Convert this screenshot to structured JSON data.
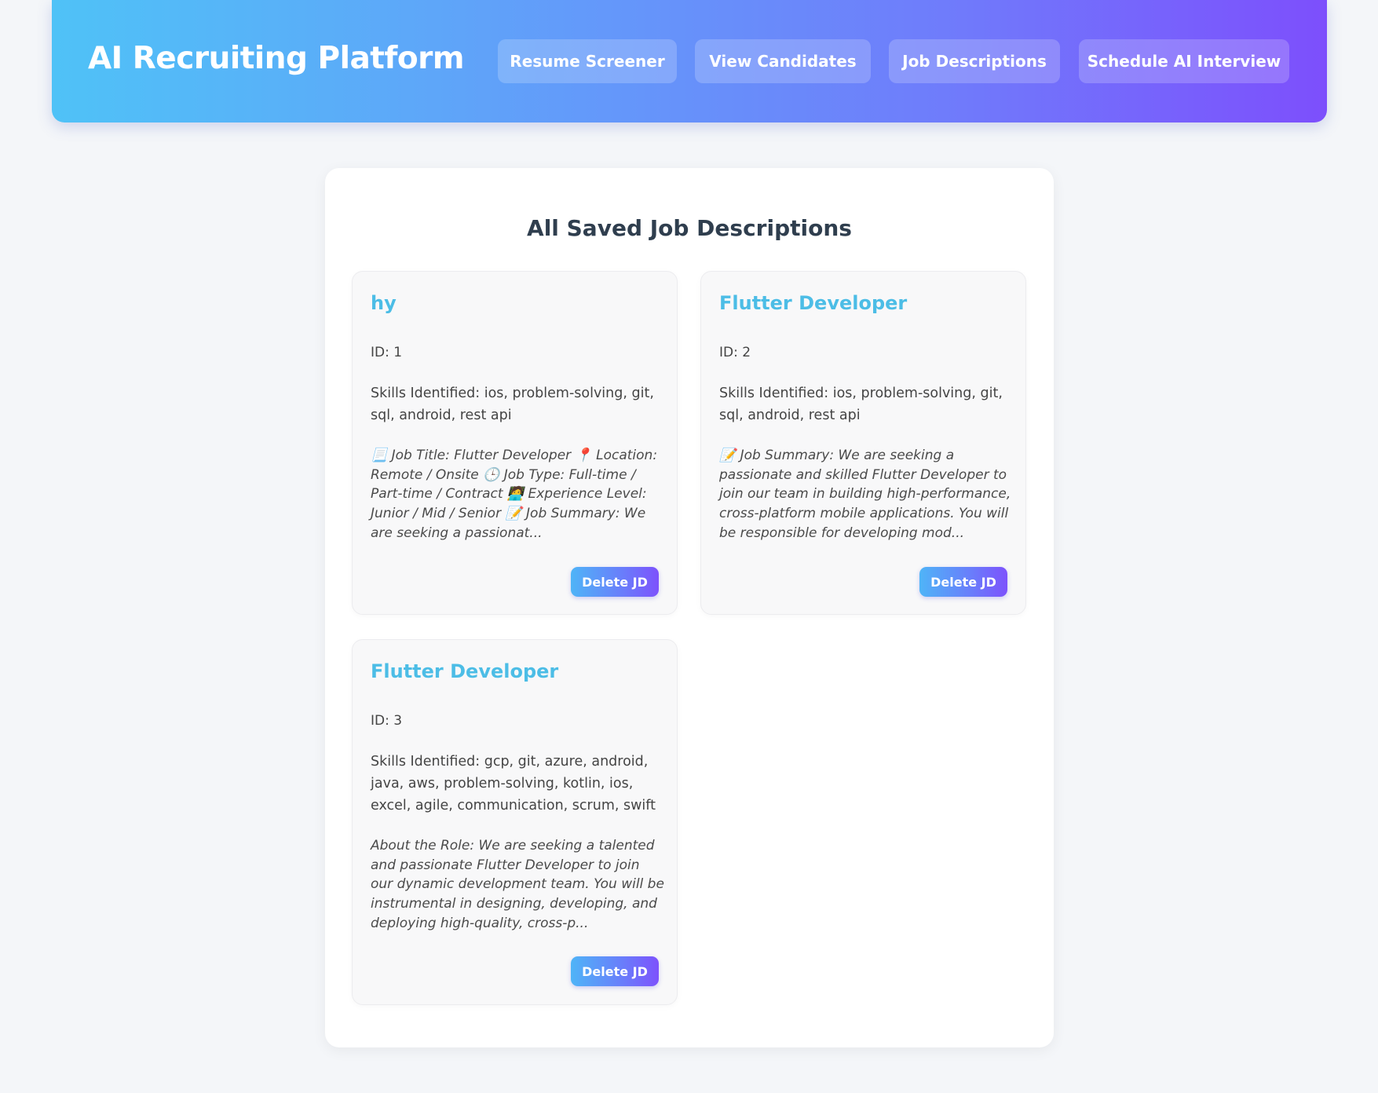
{
  "header": {
    "brand": "AI Recruiting Platform",
    "nav": [
      {
        "label": "Resume Screener"
      },
      {
        "label": "View Candidates"
      },
      {
        "label": "Job Descriptions"
      },
      {
        "label": "Schedule AI Interview"
      }
    ]
  },
  "main": {
    "title": "All Saved Job Descriptions",
    "cards": [
      {
        "title": "hy",
        "id_text": "ID: 1",
        "skills": "Skills Identified: ios, problem-solving, git, sql, android, rest api",
        "description": "📃 Job Title: Flutter Developer 📍 Location: Remote / Onsite 🕒 Job Type: Full-time / Part-time / Contract 🧑‍💻 Experience Level: Junior / Mid / Senior 📝 Job Summary: We are seeking a passionat...",
        "delete_label": "Delete JD"
      },
      {
        "title": "Flutter Developer",
        "id_text": "ID: 2",
        "skills": "Skills Identified: ios, problem-solving, git, sql, android, rest api",
        "description": "📝 Job Summary: We are seeking a passionate and skilled Flutter Developer to join our team in building high-performance, cross-platform mobile applications. You will be responsible for developing mod...",
        "delete_label": "Delete JD"
      },
      {
        "title": "Flutter Developer",
        "id_text": "ID: 3",
        "skills": "Skills Identified: gcp, git, azure, android, java, aws, problem-solving, kotlin, ios, excel, agile, communication, scrum, swift",
        "description": "About the Role: We are seeking a talented and passionate Flutter Developer to join our dynamic development team. You will be instrumental in designing, developing, and deploying high-quality, cross-p...",
        "delete_label": "Delete JD"
      }
    ]
  }
}
